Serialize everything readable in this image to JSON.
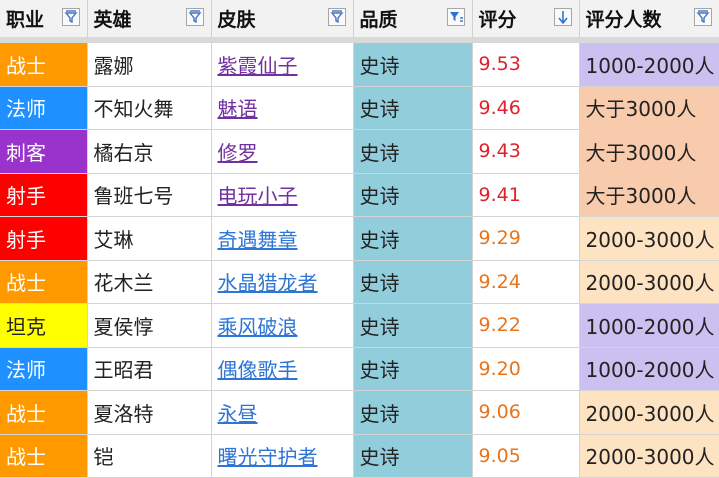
{
  "columns": [
    {
      "label": "职业",
      "filter": "filter-icon"
    },
    {
      "label": "英雄",
      "filter": "filter-icon"
    },
    {
      "label": "皮肤",
      "filter": "filter-icon"
    },
    {
      "label": "品质",
      "filter": "filter-active-icon"
    },
    {
      "label": "评分",
      "filter": "sort-descending-icon"
    },
    {
      "label": "评分人数",
      "filter": "filter-icon"
    }
  ],
  "rows": [
    {
      "job": "战士",
      "hero": "露娜",
      "skin": "紫霞仙子",
      "quality": "史诗",
      "score": "9.53",
      "raters": "1000-2000人"
    },
    {
      "job": "法师",
      "hero": "不知火舞",
      "skin": "魅语",
      "quality": "史诗",
      "score": "9.46",
      "raters": "大于3000人"
    },
    {
      "job": "刺客",
      "hero": "橘右京",
      "skin": "修罗",
      "quality": "史诗",
      "score": "9.43",
      "raters": "大于3000人"
    },
    {
      "job": "射手",
      "hero": "鲁班七号",
      "skin": "电玩小子",
      "quality": "史诗",
      "score": "9.41",
      "raters": "大于3000人"
    },
    {
      "job": "射手",
      "hero": "艾琳",
      "skin": "奇遇舞章",
      "quality": "史诗",
      "score": "9.29",
      "raters": "2000-3000人"
    },
    {
      "job": "战士",
      "hero": "花木兰",
      "skin": "水晶猎龙者",
      "quality": "史诗",
      "score": "9.24",
      "raters": "2000-3000人"
    },
    {
      "job": "坦克",
      "hero": "夏侯惇",
      "skin": "乘风破浪",
      "quality": "史诗",
      "score": "9.22",
      "raters": "1000-2000人"
    },
    {
      "job": "法师",
      "hero": "王昭君",
      "skin": "偶像歌手",
      "quality": "史诗",
      "score": "9.20",
      "raters": "1000-2000人"
    },
    {
      "job": "战士",
      "hero": "夏洛特",
      "skin": "永昼",
      "quality": "史诗",
      "score": "9.06",
      "raters": "2000-3000人"
    },
    {
      "job": "战士",
      "hero": "铠",
      "skin": "曙光守护者",
      "quality": "史诗",
      "score": "9.05",
      "raters": "2000-3000人"
    }
  ],
  "colors": {
    "job": {
      "战士": "#ff9900",
      "法师": "#1e90ff",
      "刺客": "#9933cc",
      "射手": "#ff0000",
      "坦克": "#ffff00"
    },
    "job_text": {
      "坦克": "#222222"
    },
    "quality_bg": "#92cddc",
    "raters_bg": {
      "1000-2000人": "#ccc0f0",
      "大于3000人": "#f8cbad",
      "2000-3000人": "#fde3c2"
    },
    "score_high": "#e0202a",
    "score_low": "#e8741c",
    "skin_link": {
      "visited": "#7030a0",
      "unvisited": "#2e75d6"
    }
  }
}
